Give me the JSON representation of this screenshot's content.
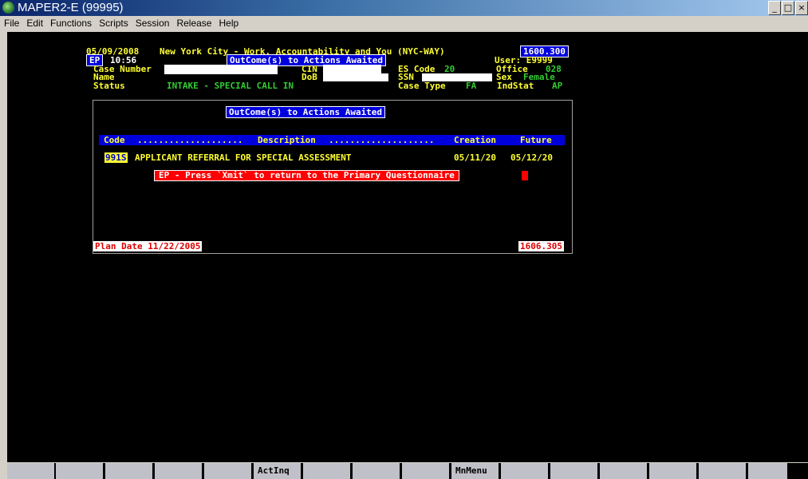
{
  "window": {
    "title": "MAPER2-E (99995)",
    "min": "_",
    "max": "□",
    "close": "×"
  },
  "menu": [
    "File",
    "Edit",
    "Functions",
    "Scripts",
    "Session",
    "Release",
    "Help"
  ],
  "header": {
    "date": "05/09/2008",
    "system_title": "New York City - Work, Accountability and You (NYC-WAY)",
    "screen_code": "1600.300",
    "mode": "EP",
    "time": "10:56",
    "popup_title": "OutCome(s) to Actions Awaited",
    "user_label": "User: E9999",
    "case_number_label": "Case Number",
    "cin_label": "CIN",
    "es_code_label": "ES Code",
    "es_code_value": "20",
    "office_label": "Office",
    "office_value": "028",
    "name_label": "Name",
    "dob_label": "DoB",
    "ssn_label": "SSN",
    "sex_label": "Sex",
    "sex_value": "Female",
    "status_label": "Status",
    "status_value": "INTAKE - SPECIAL CALL IN",
    "case_type_label": "Case Type",
    "case_type_value": "FA",
    "indstat_label": "IndStat",
    "indstat_value": "AP"
  },
  "panel": {
    "title": "OutCome(s) to Actions Awaited",
    "columns": {
      "code": "Code",
      "dots1": "....................",
      "description": "Description",
      "dots2": "....................",
      "creation": "Creation",
      "future": "Future"
    },
    "rows": [
      {
        "code": "991S",
        "description": "APPLICANT REFERRAL FOR SPECIAL ASSESSMENT",
        "creation": "05/11/20",
        "future": "05/12/20"
      }
    ],
    "message": "EP - Press `Xmit` to return to the Primary Questionnaire",
    "plan_date": "Plan Date 11/22/2005",
    "footer_code": "1606.305"
  },
  "fkeys": [
    "",
    "",
    "",
    "",
    "",
    "ActInq",
    "",
    "",
    "",
    "MnMenu",
    "",
    "",
    "",
    "",
    "",
    "",
    ""
  ]
}
